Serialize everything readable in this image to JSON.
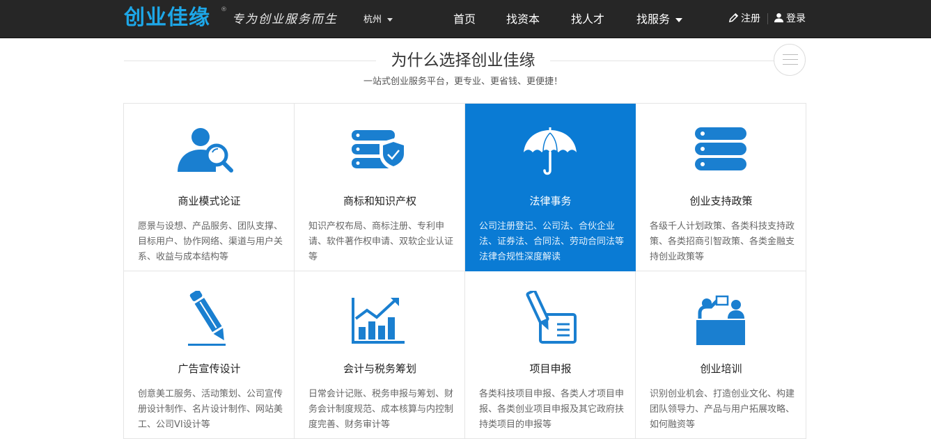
{
  "header": {
    "logo": "创业佳缘",
    "logo_reg": "®",
    "slogan": "专为创业服务而生",
    "city": "杭州",
    "nav": [
      {
        "label": "首页"
      },
      {
        "label": "找资本"
      },
      {
        "label": "找人才"
      },
      {
        "label": "找服务"
      }
    ],
    "register": "注册",
    "login": "登录"
  },
  "section": {
    "title": "为什么选择创业佳缘",
    "subtitle": "一站式创业服务平台，更专业、更省钱、更便捷！"
  },
  "cards": [
    {
      "icon": "user-search-icon",
      "title": "商业模式论证",
      "desc": "愿景与设想、产品服务、团队支撑、目标用户、协作网络、渠道与用户关系、收益与成本结构等"
    },
    {
      "icon": "server-shield-icon",
      "title": "商标和知识产权",
      "desc": "知识产权布局、商标注册、专利申请、软件著作权申请、双软企业认证等"
    },
    {
      "icon": "umbrella-icon",
      "title": "法律事务",
      "desc": "公司注册登记、公司法、合伙企业法、证券法、合同法、劳动合同法等法律合规性深度解读"
    },
    {
      "icon": "database-stack-icon",
      "title": "创业支持政策",
      "desc": "各级千人计划政策、各类科技支持政策、各类招商引智政策、各类金融支持创业政策等"
    },
    {
      "icon": "pencil-icon",
      "title": "广告宣传设计",
      "desc": "创意美工服务、活动策划、公司宣传册设计制作、名片设计制作、网站美工、公司VI设计等"
    },
    {
      "icon": "growth-chart-icon",
      "title": "会计与税务筹划",
      "desc": "日常会计记账、税务申报与筹划、财务会计制度规范、成本核算与内控制度完善、财务审计等"
    },
    {
      "icon": "pen-document-icon",
      "title": "项目申报",
      "desc": "各类科技项目申报、各类人才项目申报、各类创业项目申报及其它政府扶持类项目的申报等"
    },
    {
      "icon": "training-icon",
      "title": "创业培训",
      "desc": "识别创业机会、打造创业文化、构建团队领导力、产品与用户拓展攻略、如何融资等"
    }
  ],
  "colors": {
    "accent": "#0a7bd4",
    "icon_blue": "#1a7fd0",
    "nav_bg": "#262626",
    "logo_blue": "#1da7e8"
  }
}
